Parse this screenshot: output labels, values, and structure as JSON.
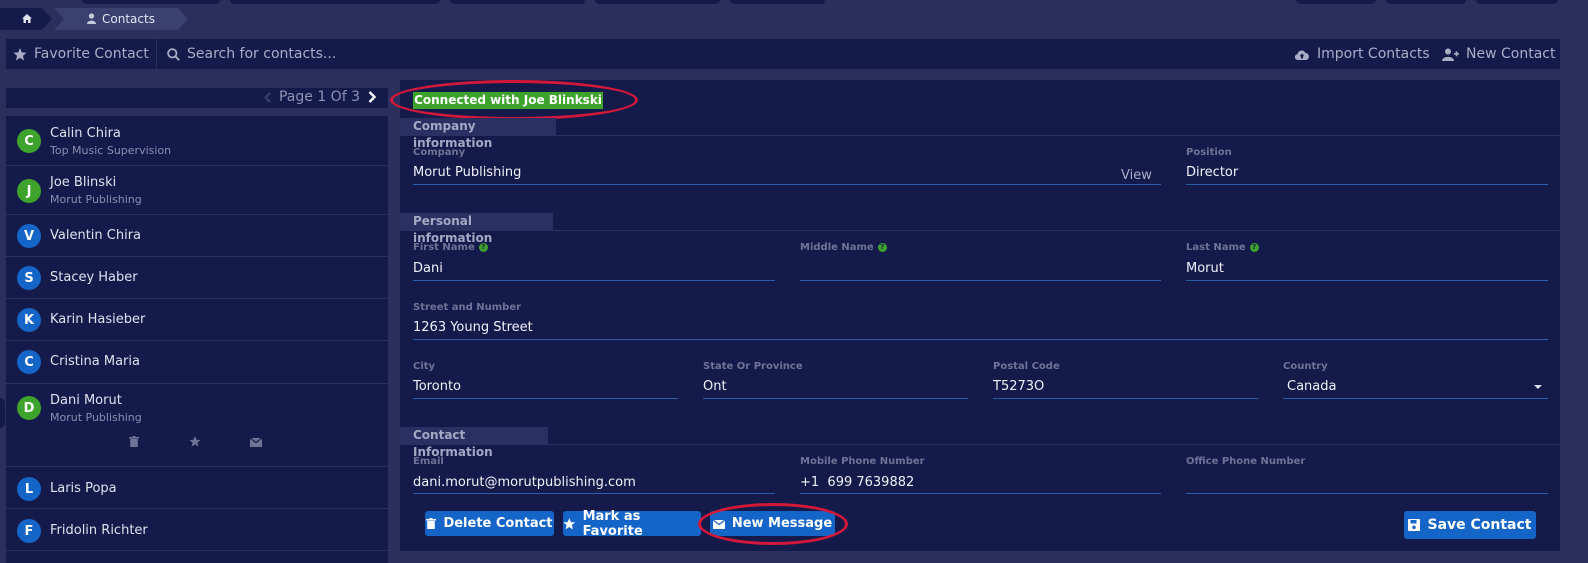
{
  "breadcrumb": {
    "contacts_label": "Contacts"
  },
  "toolbar": {
    "favorite_label": "Favorite Contact",
    "search_placeholder": "Search for contacts...",
    "import_label": "Import Contacts",
    "new_label": "New Contact"
  },
  "pager": {
    "label": "Page 1 Of 3"
  },
  "contacts": [
    {
      "initial": "C",
      "name": "Calin Chira",
      "company": "Top Music Supervision",
      "color": "#3ea32d"
    },
    {
      "initial": "J",
      "name": "Joe Blinski",
      "company": "Morut Publishing",
      "color": "#3ea32d"
    },
    {
      "initial": "V",
      "name": "Valentin Chira",
      "company": "",
      "color": "#1565c9"
    },
    {
      "initial": "S",
      "name": "Stacey Haber",
      "company": "",
      "color": "#1565c9"
    },
    {
      "initial": "K",
      "name": "Karin Hasieber",
      "company": "",
      "color": "#1565c9"
    },
    {
      "initial": "C",
      "name": "Cristina Maria",
      "company": "",
      "color": "#1565c9"
    },
    {
      "initial": "D",
      "name": "Dani Morut",
      "company": "Morut Publishing",
      "color": "#3ea32d"
    },
    {
      "initial": "L",
      "name": "Laris Popa",
      "company": "",
      "color": "#1565c9"
    },
    {
      "initial": "F",
      "name": "Fridolin Richter",
      "company": "",
      "color": "#1565c9"
    }
  ],
  "detail": {
    "connected_badge": "Connected with Joe Blinkski",
    "company_section": "Company information",
    "company_label": "Company",
    "company_value": "Morut Publishing",
    "view_link": "View",
    "position_label": "Position",
    "position_value": "Director",
    "personal_section": "Personal information",
    "first_name_label": "First Name",
    "first_name_value": "Dani",
    "middle_name_label": "Middle Name",
    "middle_name_value": "",
    "last_name_label": "Last Name",
    "last_name_value": "Morut",
    "street_label": "Street and Number",
    "street_value": "1263 Young Street",
    "city_label": "City",
    "city_value": "Toronto",
    "state_label": "State Or Province",
    "state_value": "Ont",
    "postal_label": "Postal Code",
    "postal_value": "T5273O",
    "country_label": "Country",
    "country_value": "Canada",
    "contact_section": "Contact Information",
    "email_label": "Email",
    "email_value": "dani.morut@morutpublishing.com",
    "mobile_label": "Mobile Phone Number",
    "mobile_value": "+1  699 7639882",
    "office_label": "Office Phone Number",
    "office_value": ""
  },
  "actions": {
    "delete_label": "Delete Contact",
    "favorite_label": "Mark as Favorite",
    "message_label": "New Message",
    "save_label": "Save Contact"
  },
  "colors": {
    "accent": "#1565c9",
    "success": "#3ea32d",
    "panel": "#141a4a",
    "background": "#2c2f5c",
    "highlight_ring": "#d4183a"
  }
}
